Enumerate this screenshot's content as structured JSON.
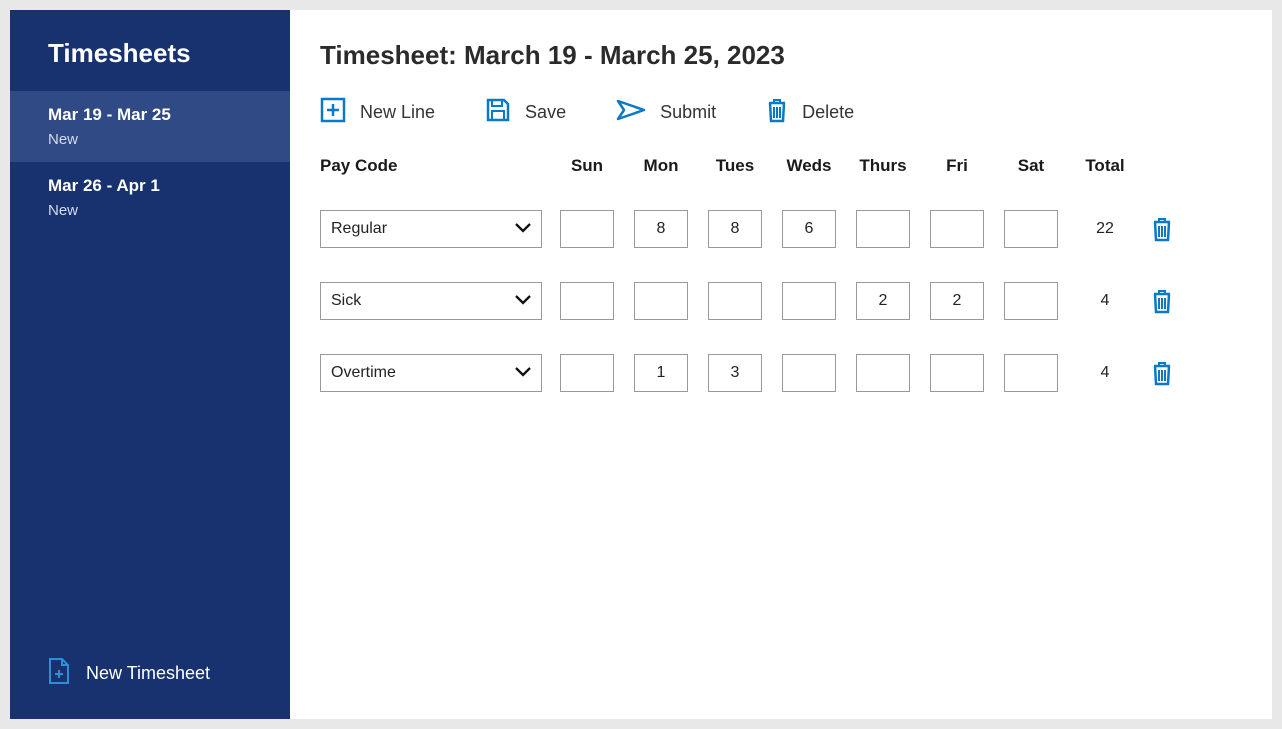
{
  "sidebar": {
    "title": "Timesheets",
    "items": [
      {
        "range": "Mar 19 - Mar 25",
        "status": "New",
        "active": true
      },
      {
        "range": "Mar 26 - Apr 1",
        "status": "New",
        "active": false
      }
    ],
    "new_timesheet_label": "New Timesheet"
  },
  "header": {
    "title": "Timesheet: March 19 - March 25, 2023"
  },
  "toolbar": {
    "new_line": "New Line",
    "save": "Save",
    "submit": "Submit",
    "delete": "Delete"
  },
  "columns": {
    "paycode": "Pay Code",
    "days": [
      "Sun",
      "Mon",
      "Tues",
      "Weds",
      "Thurs",
      "Fri",
      "Sat"
    ],
    "total": "Total"
  },
  "rows": [
    {
      "paycode": "Regular",
      "days": [
        "",
        "8",
        "8",
        "6",
        "",
        "",
        ""
      ],
      "total": "22"
    },
    {
      "paycode": "Sick",
      "days": [
        "",
        "",
        "",
        "",
        "2",
        "2",
        ""
      ],
      "total": "4"
    },
    {
      "paycode": "Overtime",
      "days": [
        "",
        "1",
        "3",
        "",
        "",
        "",
        ""
      ],
      "total": "4"
    }
  ],
  "colors": {
    "accent": "#0a7ac8",
    "sidebar_bg": "#17326e",
    "sidebar_active": "#304a85"
  }
}
